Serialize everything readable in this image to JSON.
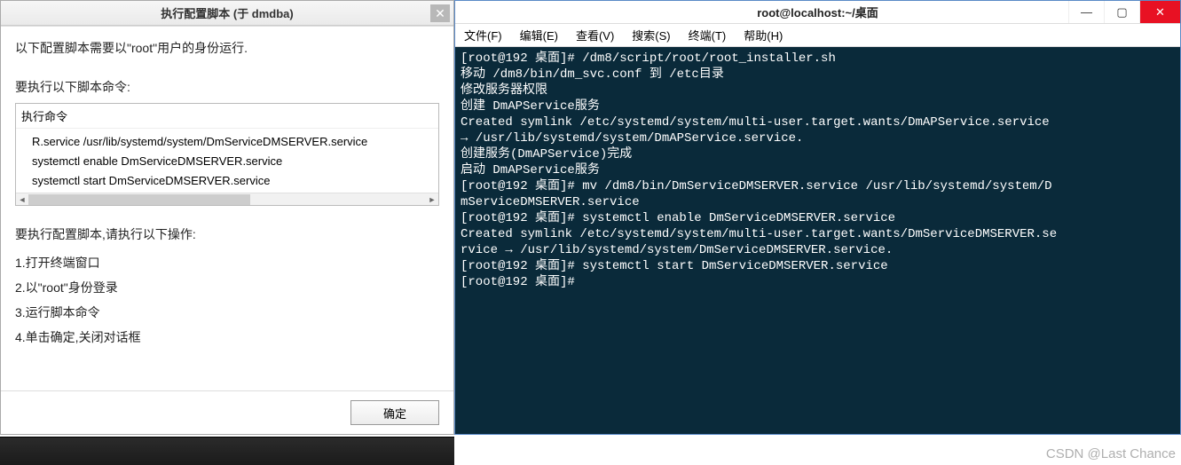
{
  "dialog": {
    "title": "执行配置脚本 (于 dmdba)",
    "close_icon": "✕",
    "intro": "以下配置脚本需要以\"root\"用户的身份运行.",
    "section_label": "要执行以下脚本命令:",
    "script_header": "执行命令",
    "scripts": [
      "R.service /usr/lib/systemd/system/DmServiceDMSERVER.service",
      "systemctl enable DmServiceDMSERVER.service",
      "systemctl start DmServiceDMSERVER.service"
    ],
    "steps_label": "要执行配置脚本,请执行以下操作:",
    "steps": [
      "1.打开终端窗口",
      "2.以\"root\"身份登录",
      "3.运行脚本命令",
      "4.单击确定,关闭对话框"
    ],
    "ok_label": "确定"
  },
  "terminal": {
    "title": "root@localhost:~/桌面",
    "menu": [
      "文件(F)",
      "编辑(E)",
      "查看(V)",
      "搜索(S)",
      "终端(T)",
      "帮助(H)"
    ],
    "win_min": "—",
    "win_max": "▢",
    "win_close": "✕",
    "output": "[root@192 桌面]# /dm8/script/root/root_installer.sh\n移动 /dm8/bin/dm_svc.conf 到 /etc目录\n修改服务器权限\n创建 DmAPService服务\nCreated symlink /etc/systemd/system/multi-user.target.wants/DmAPService.service\n→ /usr/lib/systemd/system/DmAPService.service.\n创建服务(DmAPService)完成\n启动 DmAPService服务\n[root@192 桌面]# mv /dm8/bin/DmServiceDMSERVER.service /usr/lib/systemd/system/D\nmServiceDMSERVER.service\n[root@192 桌面]# systemctl enable DmServiceDMSERVER.service\nCreated symlink /etc/systemd/system/multi-user.target.wants/DmServiceDMSERVER.se\nrvice → /usr/lib/systemd/system/DmServiceDMSERVER.service.\n[root@192 桌面]# systemctl start DmServiceDMSERVER.service\n[root@192 桌面]# "
  },
  "watermark": "CSDN @Last Chance"
}
